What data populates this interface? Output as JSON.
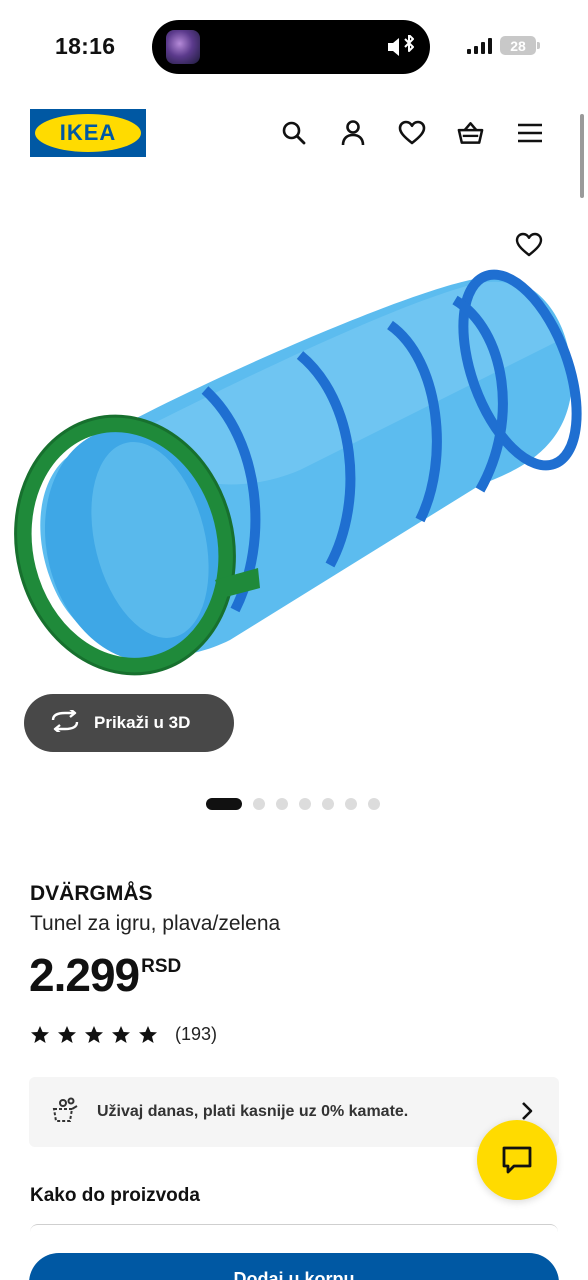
{
  "status_bar": {
    "time": "18:16",
    "battery": "28",
    "icons": [
      "mute-icon",
      "bluetooth-icon",
      "signal-icon",
      "battery-icon"
    ]
  },
  "header": {
    "logo_text": "IKEA",
    "icons": [
      "search-icon",
      "user-icon",
      "heart-icon",
      "basket-icon",
      "menu-icon"
    ]
  },
  "gallery": {
    "view_3d_label": "Prikaži u 3D",
    "dot_count": 7,
    "active_index": 0
  },
  "product": {
    "name": "DVÄRGMÅS",
    "description": "Tunel za igru, plava/zelena",
    "price": "2.299",
    "currency": "RSD",
    "rating": 5,
    "review_count": "(193)"
  },
  "promo": {
    "text": "Uživaj danas, plati kasnije uz 0% kamate."
  },
  "section": {
    "how_to_get": "Kako do proizvoda"
  },
  "cta": {
    "label": "Dodaj u korpu"
  },
  "colors": {
    "ikea_blue": "#0058a3",
    "ikea_yellow": "#ffdb00",
    "tunnel_blue": "#4fb6ec",
    "tunnel_ring": "#1f6fd1",
    "tunnel_green": "#1f8a3a"
  }
}
